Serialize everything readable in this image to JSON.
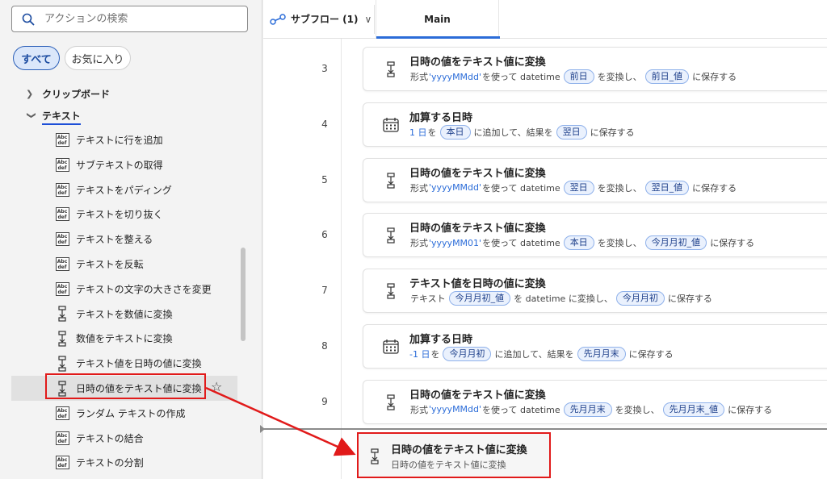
{
  "search": {
    "placeholder": "アクションの検索"
  },
  "filters": {
    "all": "すべて",
    "favorites": "お気に入り"
  },
  "tree": {
    "categories": [
      {
        "label": "クリップボード",
        "expanded": false
      },
      {
        "label": "テキスト",
        "expanded": true
      }
    ],
    "items": [
      {
        "label": "テキストに行を追加",
        "icon": "abc-def-icon"
      },
      {
        "label": "サブテキストの取得",
        "icon": "abc-def-icon"
      },
      {
        "label": "テキストをパディング",
        "icon": "abc-def-icon"
      },
      {
        "label": "テキストを切り抜く",
        "icon": "abc-def-icon"
      },
      {
        "label": "テキストを整える",
        "icon": "abc-def-icon"
      },
      {
        "label": "テキストを反転",
        "icon": "abc-def-icon"
      },
      {
        "label": "テキストの文字の大きさを変更",
        "icon": "abc-def-icon"
      },
      {
        "label": "テキストを数値に変換",
        "icon": "convert-icon"
      },
      {
        "label": "数値をテキストに変換",
        "icon": "convert-icon"
      },
      {
        "label": "テキスト値を日時の値に変換",
        "icon": "convert-icon"
      },
      {
        "label": "日時の値をテキスト値に変換",
        "icon": "convert-icon",
        "selected": true
      },
      {
        "label": "ランダム テキストの作成",
        "icon": "abc-def-icon"
      },
      {
        "label": "テキストの結合",
        "icon": "abc-def-icon"
      },
      {
        "label": "テキストの分割",
        "icon": "abc-def-icon"
      }
    ]
  },
  "tabs": {
    "subflow_label": "サブフロー (1)",
    "main_label": "Main"
  },
  "steps": [
    {
      "num": "3",
      "title": "日時の値をテキスト値に変換",
      "desc": [
        {
          "t": "形式 "
        },
        {
          "lit": "'yyyyMMdd'"
        },
        {
          "t": " を使って datetime "
        },
        {
          "v": "前日"
        },
        {
          "t": " を変換し、"
        },
        {
          "v": "前日_値"
        },
        {
          "t": " に保存する"
        }
      ]
    },
    {
      "num": "4",
      "title": "加算する日時",
      "desc": [
        {
          "lit": "1 日"
        },
        {
          "t": " を "
        },
        {
          "v": "本日"
        },
        {
          "t": " に追加して、結果を "
        },
        {
          "v": "翌日"
        },
        {
          "t": " に保存する"
        }
      ]
    },
    {
      "num": "5",
      "title": "日時の値をテキスト値に変換",
      "desc": [
        {
          "t": "形式 "
        },
        {
          "lit": "'yyyyMMdd'"
        },
        {
          "t": " を使って datetime "
        },
        {
          "v": "翌日"
        },
        {
          "t": " を変換し、"
        },
        {
          "v": "翌日_値"
        },
        {
          "t": " に保存する"
        }
      ]
    },
    {
      "num": "6",
      "title": "日時の値をテキスト値に変換",
      "desc": [
        {
          "t": "形式 "
        },
        {
          "lit": "'yyyyMM01'"
        },
        {
          "t": " を使って datetime "
        },
        {
          "v": "本日"
        },
        {
          "t": " を変換し、"
        },
        {
          "v": "今月月初_値"
        },
        {
          "t": " に保存する"
        }
      ]
    },
    {
      "num": "7",
      "title": "テキスト値を日時の値に変換",
      "desc": [
        {
          "t": "テキスト "
        },
        {
          "v": "今月月初_値"
        },
        {
          "t": " を datetime に変換し、"
        },
        {
          "v": "今月月初"
        },
        {
          "t": " に保存する"
        }
      ]
    },
    {
      "num": "8",
      "title": "加算する日時",
      "desc": [
        {
          "lit": "-1 日"
        },
        {
          "t": " を "
        },
        {
          "v": "今月月初"
        },
        {
          "t": " に追加して、結果を "
        },
        {
          "v": "先月月末"
        },
        {
          "t": " に保存する"
        }
      ]
    },
    {
      "num": "9",
      "title": "日時の値をテキスト値に変換",
      "desc": [
        {
          "t": "形式 "
        },
        {
          "lit": "'yyyyMMdd'"
        },
        {
          "t": " を使って datetime "
        },
        {
          "v": "先月月末"
        },
        {
          "t": " を変換し、"
        },
        {
          "v": "先月月末_値"
        },
        {
          "t": " に保存する"
        }
      ]
    }
  ],
  "drag_preview": {
    "title": "日時の値をテキスト値に変換",
    "desc": "日時の値をテキスト値に変換"
  },
  "colors": {
    "accent": "#2b6cd8",
    "highlight": "#e11a1a",
    "variable_bg": "#eaf1fd"
  }
}
